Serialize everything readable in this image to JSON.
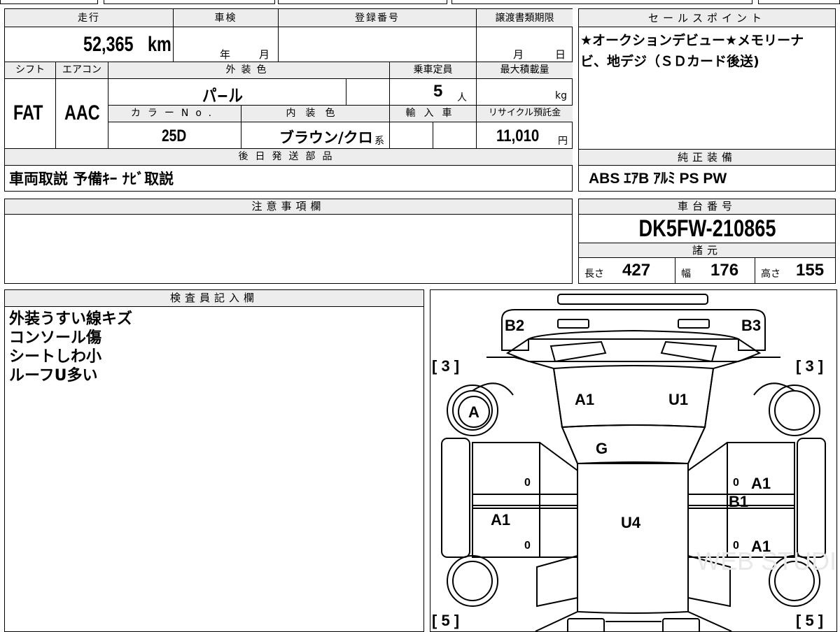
{
  "sheet": {
    "mileage": {
      "label": "走行",
      "value": "52,365",
      "unit": "km"
    },
    "shaken": {
      "label": "車検",
      "year_unit": "年",
      "month_unit": "月"
    },
    "registration": {
      "label": "登録番号"
    },
    "transfer_deadline": {
      "label": "譲渡書類期限",
      "month_unit": "月",
      "day_unit": "日"
    },
    "shift": {
      "label": "シフト",
      "value": "FAT"
    },
    "aircon": {
      "label": "エアコン",
      "value": "AAC"
    },
    "exterior_color": {
      "label": "外装色",
      "value": "パ−ル"
    },
    "capacity": {
      "label": "乗車定員",
      "value": "5",
      "unit": "人"
    },
    "max_load": {
      "label": "最大積載量",
      "unit": "kg"
    },
    "color_no": {
      "label": "カラーNo.",
      "value": "25D"
    },
    "interior_color": {
      "label": "内装色",
      "value": "ブラウン/クロ",
      "suffix": "系"
    },
    "import_car": {
      "label": "輸入車"
    },
    "recycle_fee": {
      "label": "リサイクル預託金",
      "value": "11,010",
      "unit": "円"
    },
    "later_parts": {
      "label": "後日発送部品",
      "value": "車両取説 予備ｷｰ ﾅﾋﾞ取説"
    },
    "caution": {
      "label": "注意事項欄"
    },
    "inspector": {
      "label": "検査員記入欄",
      "lines": [
        "外装うすい線キズ",
        "コンソール傷",
        "シートしわ小",
        "ルーフU多い"
      ]
    }
  },
  "sales_points": {
    "label": "セールスポイント",
    "text": "★オークションデビュー★メモリーナビ、地デジ（ＳＤカード後送)"
  },
  "standard_equipment": {
    "label": "純正装備",
    "value": "ABS ｴｱB ｱﾙﾐ PS PW"
  },
  "chassis": {
    "label": "車台番号",
    "value": "DK5FW-210865"
  },
  "specs": {
    "label": "諸元",
    "length": {
      "label": "長さ",
      "value": "427"
    },
    "width": {
      "label": "幅",
      "value": "176"
    },
    "height": {
      "label": "高さ",
      "value": "155"
    }
  },
  "diagram": {
    "marks": {
      "b2": "B2",
      "b3": "B3",
      "tyre_fl": "[ 3 ]",
      "tyre_fr": "[ 3 ]",
      "tyre_rl": "[ 5 ]",
      "tyre_rr": "[ 5 ]",
      "a_wheel": "A",
      "windshield_a1": "A1",
      "windshield_u1": "U1",
      "hood_g": "G",
      "left_a1": "A1",
      "roof_u4": "U4",
      "right_a1_front": "A1",
      "right_b1": "B1",
      "right_a1_rear": "A1",
      "zero_1": "0",
      "zero_2": "0",
      "zero_3": "0",
      "zero_4": "0"
    },
    "watermark": "WEB STUDIO PRO"
  }
}
